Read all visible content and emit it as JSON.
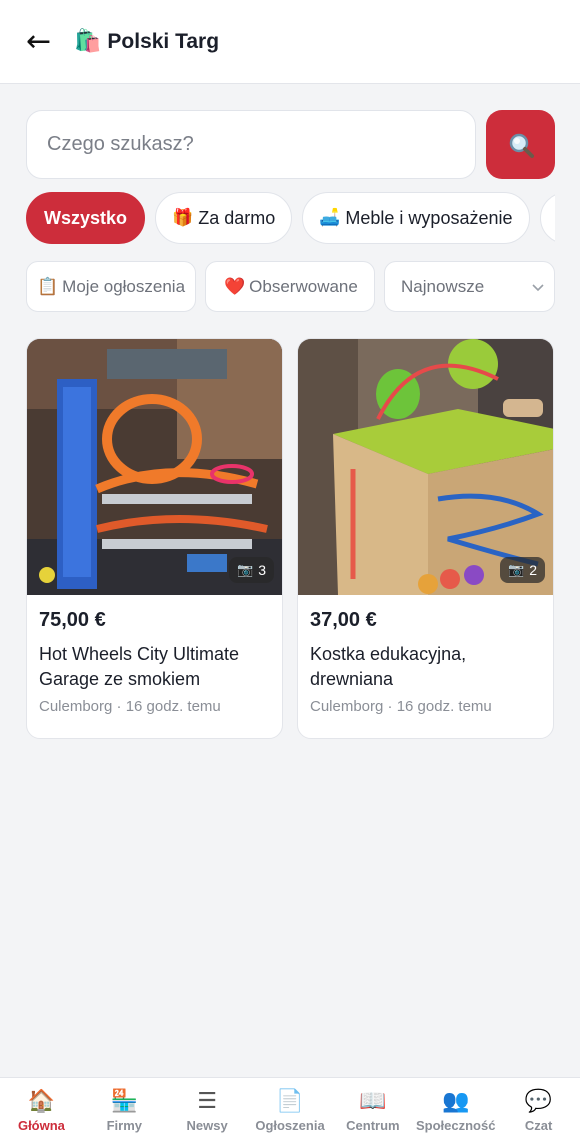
{
  "header": {
    "back_icon": "←",
    "brand_icon": "🛍️",
    "title": "Polski Targ"
  },
  "search": {
    "placeholder": "Czego szukasz?",
    "button_icon": "search-icon"
  },
  "categories": [
    {
      "label": "Wszystko",
      "icon": "",
      "active": true
    },
    {
      "label": "Za darmo",
      "icon": "🎁"
    },
    {
      "label": "Meble i wyposażenie",
      "icon": "🛋️"
    },
    {
      "label": "",
      "icon": "🔌"
    }
  ],
  "filters": {
    "my_listings": {
      "label": "Moje ogłoszenia",
      "icon": "📋"
    },
    "watched": {
      "label": "Obserwowane",
      "icon": "❤️"
    },
    "sort": {
      "selected": "Najnowsze"
    }
  },
  "listings": [
    {
      "price": "75,00 €",
      "title": "Hot Wheels City Ultimate Garage ze smokiem",
      "location": "Culemborg",
      "time": "16 godz. temu",
      "meta": "Culemborg · 16 godz. temu",
      "photo_count": "3"
    },
    {
      "price": "37,00 €",
      "title": "Kostka edukacyjna, drewniana",
      "location": "Culemborg",
      "time": "16 godz. temu",
      "meta": "Culemborg · 16 godz. temu",
      "photo_count": "2"
    }
  ],
  "bottom_nav": [
    {
      "label": "Główna",
      "icon": "🏠",
      "active": true
    },
    {
      "label": "Firmy",
      "icon": "🏪"
    },
    {
      "label": "Newsy",
      "icon": "☰"
    },
    {
      "label": "Ogłoszenia",
      "icon": "📄"
    },
    {
      "label": "Centrum",
      "icon": "📖"
    },
    {
      "label": "Społeczność",
      "icon": "👥"
    },
    {
      "label": "Czat",
      "icon": "💬"
    }
  ],
  "colors": {
    "accent": "#cd2d3b",
    "background": "#f3f4f6"
  }
}
